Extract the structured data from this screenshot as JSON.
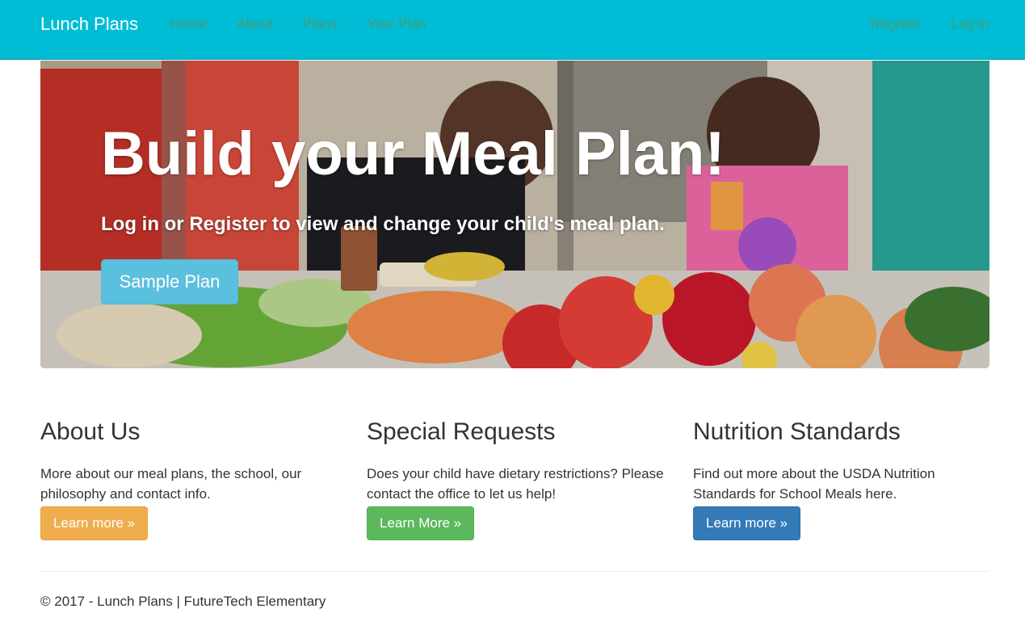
{
  "navbar": {
    "brand": "Lunch Plans",
    "left_items": [
      "Home",
      "About",
      "Plans",
      "Your Plan"
    ],
    "right_items": [
      "Register",
      "Log in"
    ]
  },
  "hero": {
    "title": "Build your Meal Plan!",
    "subtitle": "Log in or Register to view and change your child's meal plan.",
    "button_label": "Sample Plan",
    "image_description": "children-at-school-lunch-line-photo"
  },
  "columns": [
    {
      "heading": "About Us",
      "text": "More about our meal plans, the school, our philosophy and contact info.",
      "button_label": "Learn more »",
      "button_color": "#f0ad4e"
    },
    {
      "heading": "Special Requests",
      "text": "Does your child have dietary restrictions? Please contact the office to let us help!",
      "button_label": "Learn More »",
      "button_color": "#5cb85c"
    },
    {
      "heading": "Nutrition Standards",
      "text": "Find out more about the USDA Nutrition Standards for School Meals here.",
      "button_label": "Learn more »",
      "button_color": "#337ab7"
    }
  ],
  "footer": {
    "text": "© 2017 - Lunch Plans | FutureTech Elementary"
  },
  "colors": {
    "navbar_bg": "#00bcd4",
    "nav_link": "#4a9a73",
    "hero_button": "#5bc0de"
  }
}
